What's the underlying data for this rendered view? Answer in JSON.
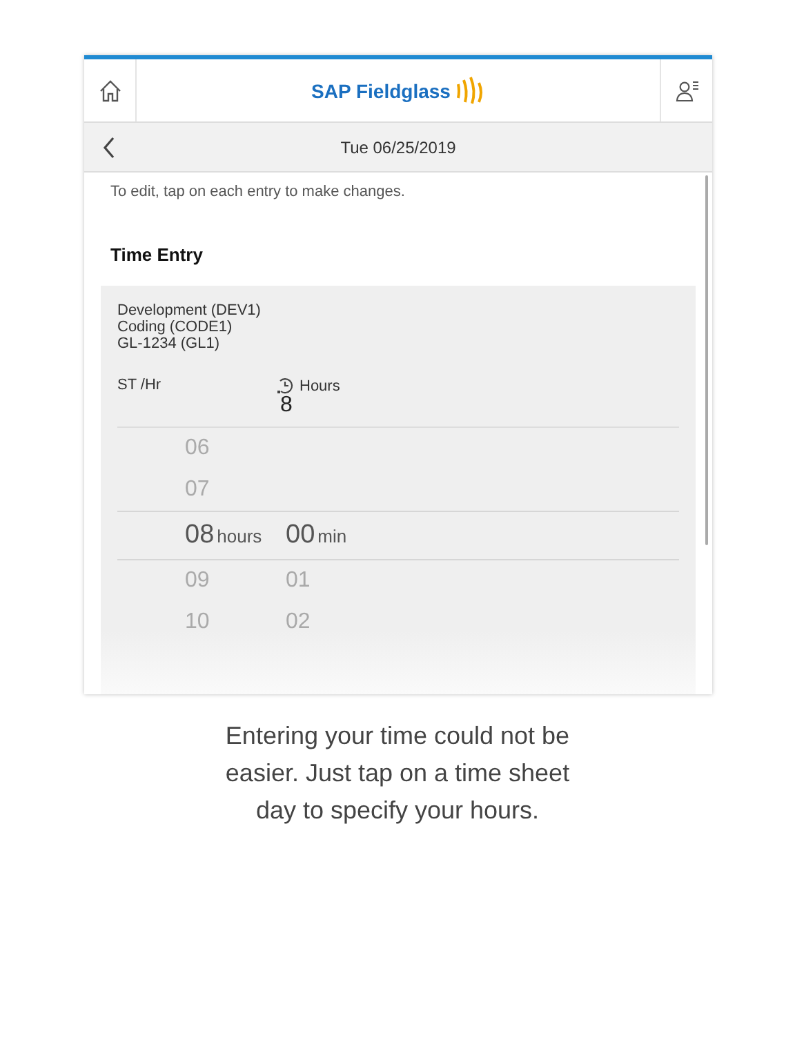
{
  "header": {
    "brand": "SAP Fieldglass"
  },
  "subheader": {
    "date": "Tue 06/25/2019"
  },
  "instruction": "To edit, tap on each entry to make changes.",
  "section_title": "Time Entry",
  "entry": {
    "lines": [
      "Development (DEV1)",
      "Coding (CODE1)",
      "GL-1234 (GL1)"
    ],
    "rate_label": "ST /Hr",
    "hours_label": "Hours",
    "hours_value": "8"
  },
  "picker": {
    "hour_unit": "hours",
    "minute_unit": "min",
    "rows": [
      {
        "hour": "06",
        "selected": false
      },
      {
        "hour": "07",
        "selected": false
      },
      {
        "hour": "08",
        "minute": "00",
        "selected": true
      },
      {
        "hour": "09",
        "minute": "01",
        "selected": false
      },
      {
        "hour": "10",
        "minute": "02",
        "selected": false
      }
    ]
  },
  "caption": "Entering your time could not be easier. Just tap on a time sheet day to specify your hours."
}
